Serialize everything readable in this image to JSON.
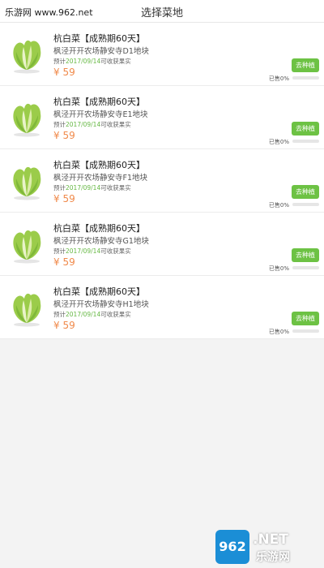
{
  "watermark": {
    "top": "乐游网 www.962.net",
    "bottom_num": "962",
    "bottom_net": ".NET",
    "bottom_cn": "乐游网"
  },
  "header": {
    "title": "选择菜地"
  },
  "items": [
    {
      "name": "杭白菜【成熟期60天】",
      "location": "枫泾开开农场静安寺D1地块",
      "date_prefix": "预计",
      "date": "2017/09/14",
      "date_suffix": "可收获果实",
      "price": "¥ 59",
      "button": "去种植",
      "sold": "已售0%",
      "progress": 0,
      "icon": "cabbage-icon"
    },
    {
      "name": "杭白菜【成熟期60天】",
      "location": "枫泾开开农场静安寺E1地块",
      "date_prefix": "预计",
      "date": "2017/09/14",
      "date_suffix": "可收获果实",
      "price": "¥ 59",
      "button": "去种植",
      "sold": "已售0%",
      "progress": 0,
      "icon": "cabbage-icon"
    },
    {
      "name": "杭白菜【成熟期60天】",
      "location": "枫泾开开农场静安寺F1地块",
      "date_prefix": "预计",
      "date": "2017/09/14",
      "date_suffix": "可收获果实",
      "price": "¥ 59",
      "button": "去种植",
      "sold": "已售0%",
      "progress": 0,
      "icon": "cabbage-icon"
    },
    {
      "name": "杭白菜【成熟期60天】",
      "location": "枫泾开开农场静安寺G1地块",
      "date_prefix": "预计",
      "date": "2017/09/14",
      "date_suffix": "可收获果实",
      "price": "¥ 59",
      "button": "去种植",
      "sold": "已售0%",
      "progress": 0,
      "icon": "cabbage-icon"
    },
    {
      "name": "杭白菜【成熟期60天】",
      "location": "枫泾开开农场静安寺H1地块",
      "date_prefix": "预计",
      "date": "2017/09/14",
      "date_suffix": "可收获果实",
      "price": "¥ 59",
      "button": "去种植",
      "sold": "已售0%",
      "progress": 0,
      "icon": "cabbage-icon"
    }
  ],
  "colors": {
    "accent_green": "#6dc244",
    "price_orange": "#f08a4b",
    "date_green": "#66b844"
  }
}
